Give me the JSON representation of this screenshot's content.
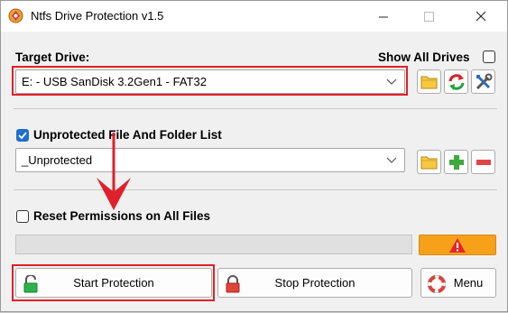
{
  "window": {
    "title": "Ntfs Drive Protection v1.5"
  },
  "target": {
    "label": "Target Drive:",
    "show_all_label": "Show All Drives",
    "show_all_checked": false,
    "selected": "E:  - USB SanDisk 3.2Gen1 - FAT32"
  },
  "unprotected": {
    "label": "Unprotected File And Folder List",
    "checked": true,
    "selected": "_Unprotected"
  },
  "reset": {
    "label": "Reset Permissions on All Files",
    "checked": false
  },
  "progress": {
    "value": 0
  },
  "buttons": {
    "start": "Start Protection",
    "stop": "Stop Protection",
    "menu": "Menu"
  },
  "icons": {
    "app": "shield-app-icon",
    "folder": "folder-icon",
    "refresh": "refresh-icon",
    "tools": "tools-icon",
    "add": "plus-icon",
    "remove": "minus-icon",
    "warning": "warning-icon",
    "lock_green": "lock-open-icon",
    "lock_red": "lock-closed-icon",
    "lifebuoy": "lifebuoy-icon"
  },
  "colors": {
    "highlight": "#e0202a",
    "warning_bg": "#f7a01a",
    "check_blue": "#1f6fd0"
  }
}
